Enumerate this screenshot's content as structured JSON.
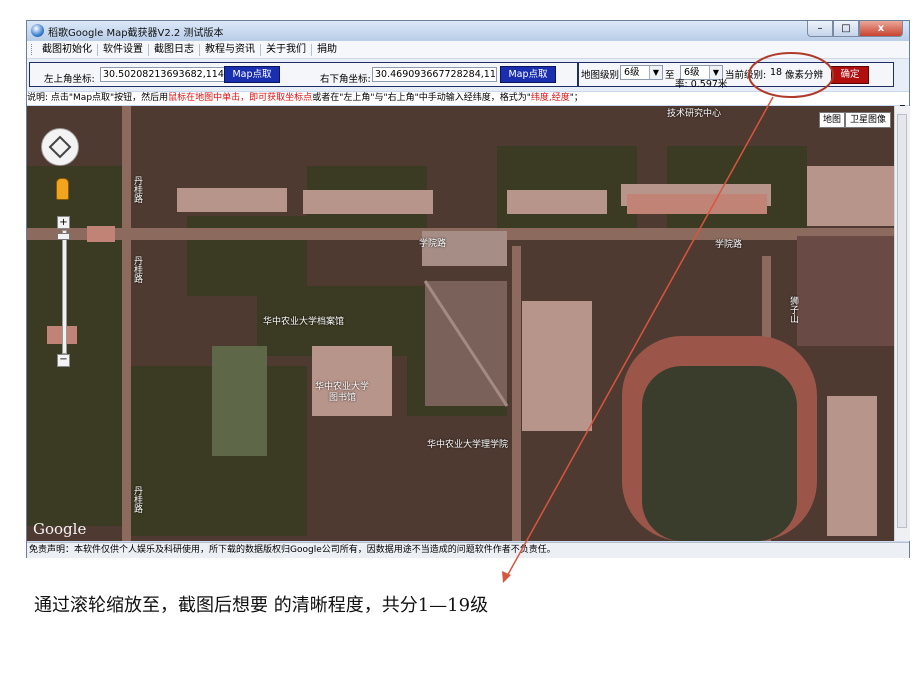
{
  "window": {
    "title": "稻歌Google Map截获器V2.2 测试版本",
    "min": "–",
    "max": "□",
    "close": "x"
  },
  "menu": [
    "截图初始化",
    "软件设置",
    "截图日志",
    "教程与资讯",
    "关于我们",
    "捐助"
  ],
  "toolbar": {
    "topleft_label": "左上角坐标:",
    "topleft_value": "30.50208213693682,114.3",
    "topleft_btn": "Map点取",
    "bottomright_label": "右下角坐标:",
    "bottomright_value": "30.469093667728284,114.",
    "bottomright_btn": "Map点取",
    "level_label": "地图级别:",
    "level_from": "6级",
    "level_to_label": "至",
    "level_to": "6级",
    "current_label": "当前级别:",
    "current_value": "18",
    "resolution_label": "像素分辨",
    "resolution_value": "率: 0.597米",
    "confirm_btn": "确定"
  },
  "info": {
    "part1": "说明: 点击\"Map点取\"按钮，然后用",
    "part2": "鼠标在地图中单击，即可获取坐标点",
    "part3": "或者在\"左上角\"与\"右上角\"中手动输入经纬度，格式为\"",
    "part4": "纬度,经度",
    "part5": "\"；"
  },
  "map": {
    "type_map": "地图",
    "type_satellite": "卫星图像",
    "labels": [
      "学院路",
      "学院路",
      "丹桂路",
      "丹桂路",
      "华中农业大学档案馆",
      "华中农业大学",
      "图书馆",
      "华中农业大学理学院",
      "狮子山",
      "丹桂路",
      "技术研究中心"
    ],
    "google": "Google"
  },
  "status": "免责声明：本软件仅供个人娱乐及科研使用，所下载的数据版权归Google公司所有，因数据用途不当造成的问题软件作者不负责任。",
  "caption": "通过滚轮缩放至，截图后想要 的清晰程度，共分1—19级",
  "colors": {
    "annotation": "#b03a2a",
    "map_button": "#1a2fb0",
    "confirm_button": "#b10e0e"
  }
}
